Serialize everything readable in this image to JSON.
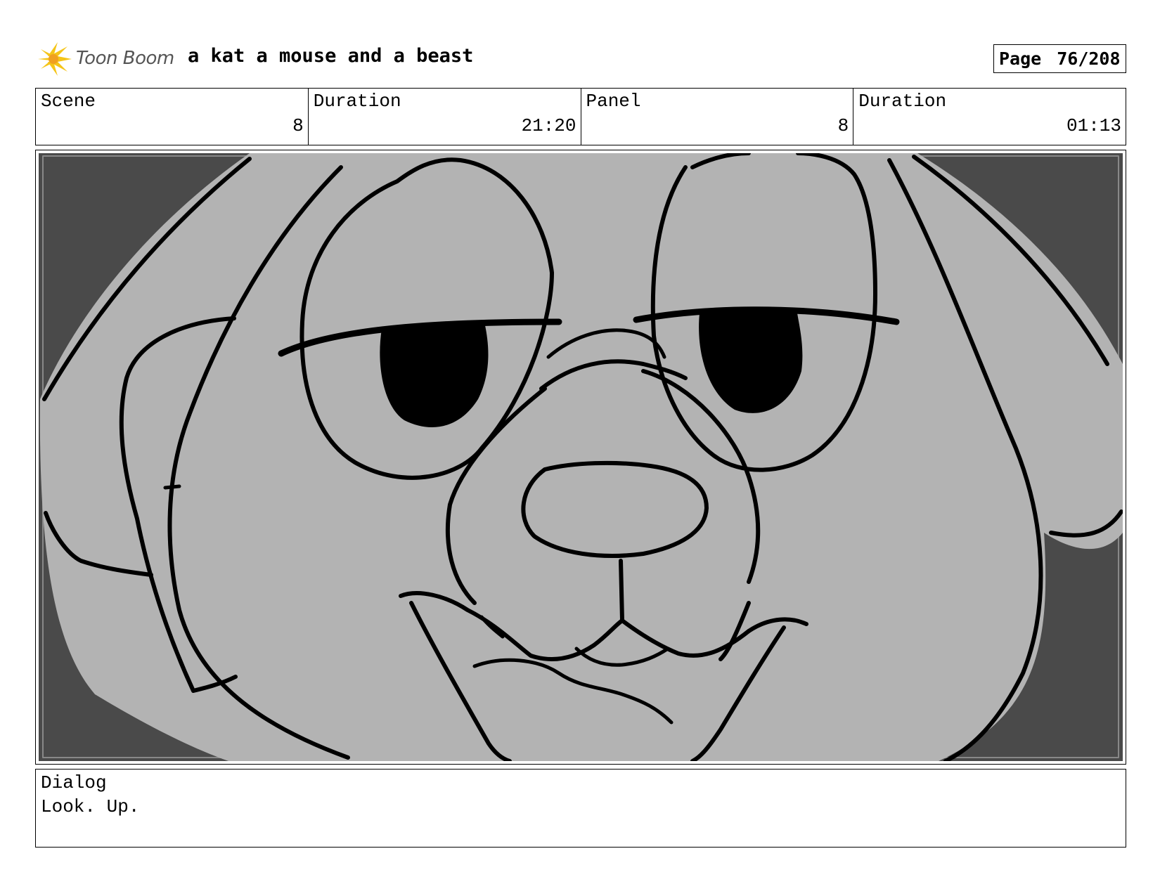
{
  "header": {
    "logo_text": "Toon Boom",
    "project_title": "a kat a mouse and a beast",
    "page_label": "Page",
    "page_value": "76/208"
  },
  "info": {
    "scene_label": "Scene",
    "scene_value": "8",
    "duration_label": "Duration",
    "duration_value": "21:20",
    "panel_label": "Panel",
    "panel_value": "8",
    "panel_duration_label": "Duration",
    "panel_duration_value": "01:13"
  },
  "dialog": {
    "label": "Dialog",
    "text": "Look. Up."
  },
  "colors": {
    "frame_dark": "#4a4a4a",
    "face_gray": "#b3b3b3",
    "ink": "#000000",
    "logo_yellow": "#f5c518"
  }
}
